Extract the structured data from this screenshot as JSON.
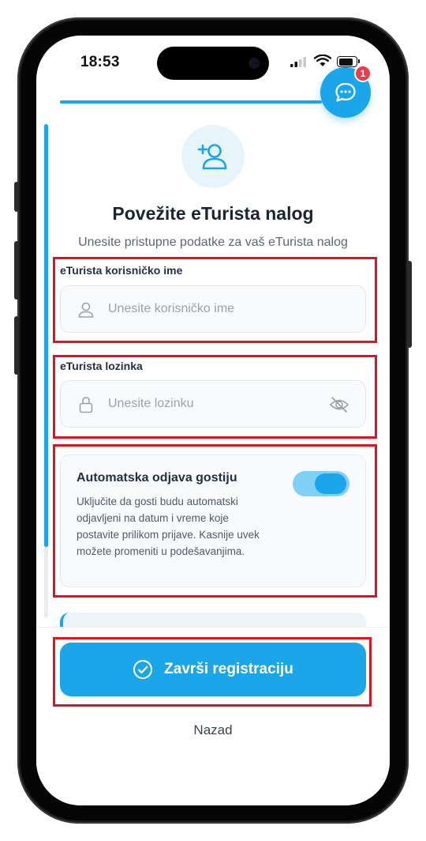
{
  "status_bar": {
    "time": "18:53"
  },
  "chat": {
    "badge_count": "1"
  },
  "progress": {
    "fraction": 0.85
  },
  "header": {
    "icon": "add-user-icon",
    "title": "Povežite eTurista nalog",
    "subtitle": "Unesite pristupne podatke za vaš eTurista nalog"
  },
  "username": {
    "label": "eTurista korisničko ime",
    "placeholder": "Unesite korisničko ime",
    "icon": "user-icon"
  },
  "password": {
    "label": "eTurista lozinka",
    "placeholder": "Unesite lozinku",
    "icon": "lock-icon",
    "toggle_icon": "eye-off-icon"
  },
  "auto_checkout": {
    "title": "Automatska odjava gostiju",
    "description": "Uključite da gosti budu automatski odjavljeni na datum i vreme koje postavite prilikom prijave. Kasnije uvek možete promeniti u podešavanjima.",
    "enabled": true
  },
  "actions": {
    "finish_label": "Završi registraciju",
    "finish_icon": "check-circle-icon",
    "back_label": "Nazad"
  },
  "colors": {
    "accent": "#1aa6e8",
    "highlight": "#e0141e",
    "badge": "#ef3b4a"
  }
}
